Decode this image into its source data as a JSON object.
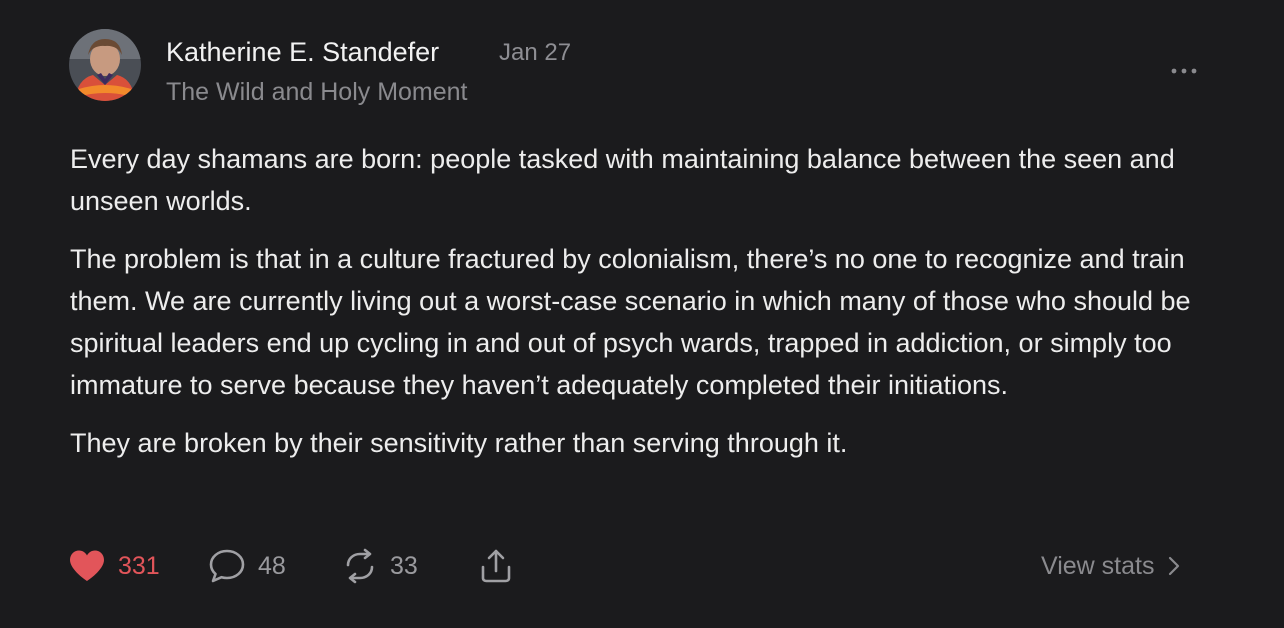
{
  "post": {
    "author": "Katherine E. Standefer",
    "date": "Jan 27",
    "publication": "The Wild and Holy Moment",
    "paragraphs": [
      "Every day shamans are born: people tasked with maintaining balance between the seen and unseen worlds.",
      "The problem is that in a culture fractured by colonialism, there’s no one to recognize and train them. We are currently living out a worst-case scenario in which many of those who should be spiritual leaders end up cycling in and out of psych wards, trapped in addiction, or simply too immature to serve because they haven’t adequately completed their initiations.",
      "They are broken by their sensitivity rather than serving through it."
    ]
  },
  "actions": {
    "likes": "331",
    "comments": "48",
    "restacks": "33",
    "view_stats_label": "View stats"
  },
  "icons": {
    "like": "heart-icon",
    "comment": "speech-bubble-icon",
    "restack": "restack-arrows-icon",
    "share": "share-upload-icon",
    "more": "more-dots-icon",
    "view_stats": "chevron-right-icon"
  },
  "colors": {
    "background": "#1b1b1d",
    "like_accent": "#e2555a",
    "text_primary": "#ededed",
    "text_secondary": "#8a8a8e"
  }
}
